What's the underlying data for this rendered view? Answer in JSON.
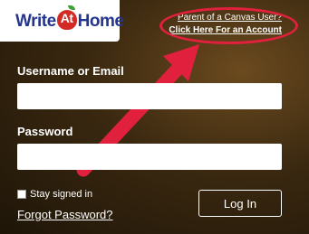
{
  "branding": {
    "logo_word_1": "Write",
    "logo_word_at": "At",
    "logo_word_2": "Home"
  },
  "header": {
    "parent_question": "Parent of a Canvas User?",
    "parent_link": "Click Here For an Account"
  },
  "form": {
    "username_label": "Username or Email",
    "username_value": "",
    "password_label": "Password",
    "password_value": "",
    "stay_signed_in_label": "Stay signed in",
    "stay_signed_in_checked": false,
    "forgot_password": "Forgot Password?",
    "login_button": "Log In"
  },
  "annotation": {
    "arrow_color": "#e0203c",
    "callout_color": "#e0203c"
  },
  "colors": {
    "logo_blue": "#23358f",
    "apple_red": "#d42a26",
    "text": "#ffffff"
  }
}
